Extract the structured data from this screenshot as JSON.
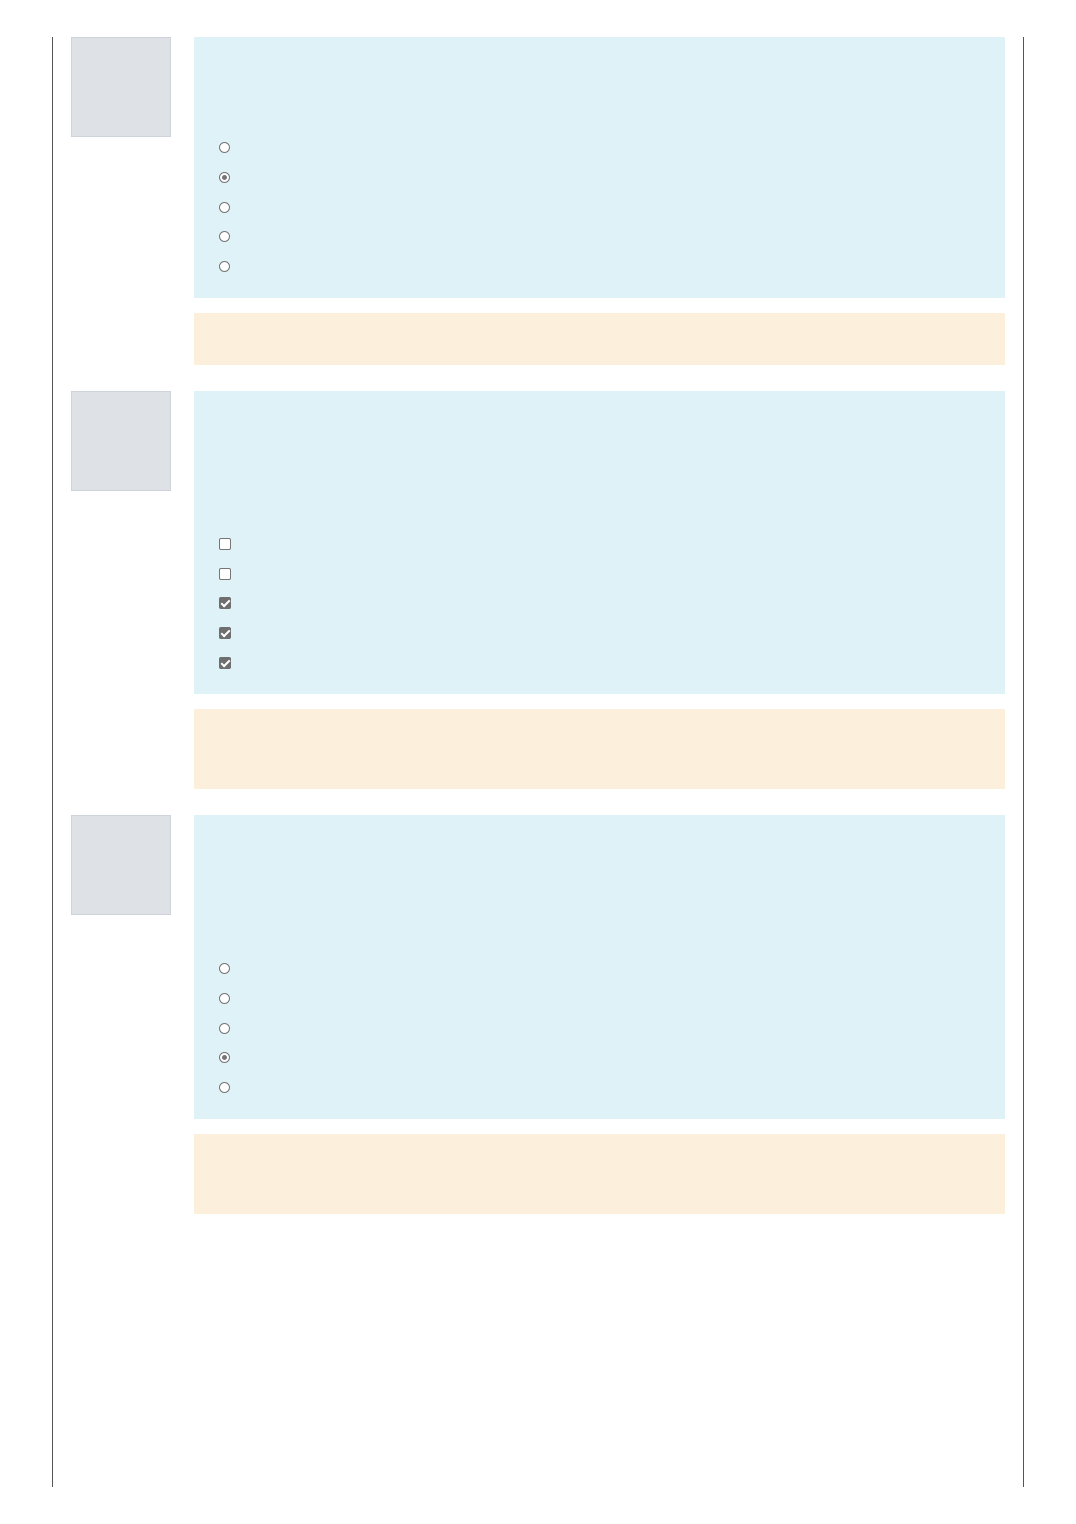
{
  "questions": [
    {
      "input_type": "radio",
      "options": [
        {
          "checked": false
        },
        {
          "checked": true
        },
        {
          "checked": false
        },
        {
          "checked": false
        },
        {
          "checked": false
        }
      ]
    },
    {
      "input_type": "checkbox",
      "options": [
        {
          "checked": false
        },
        {
          "checked": false
        },
        {
          "checked": true
        },
        {
          "checked": true
        },
        {
          "checked": true
        }
      ]
    },
    {
      "input_type": "radio",
      "options": [
        {
          "checked": false
        },
        {
          "checked": false
        },
        {
          "checked": false
        },
        {
          "checked": true
        },
        {
          "checked": false
        }
      ]
    }
  ],
  "colors": {
    "question_background": "#def2f8",
    "feedback_background": "#fcefdc",
    "info_background": "#dee2e6",
    "control_border": "#767676"
  }
}
